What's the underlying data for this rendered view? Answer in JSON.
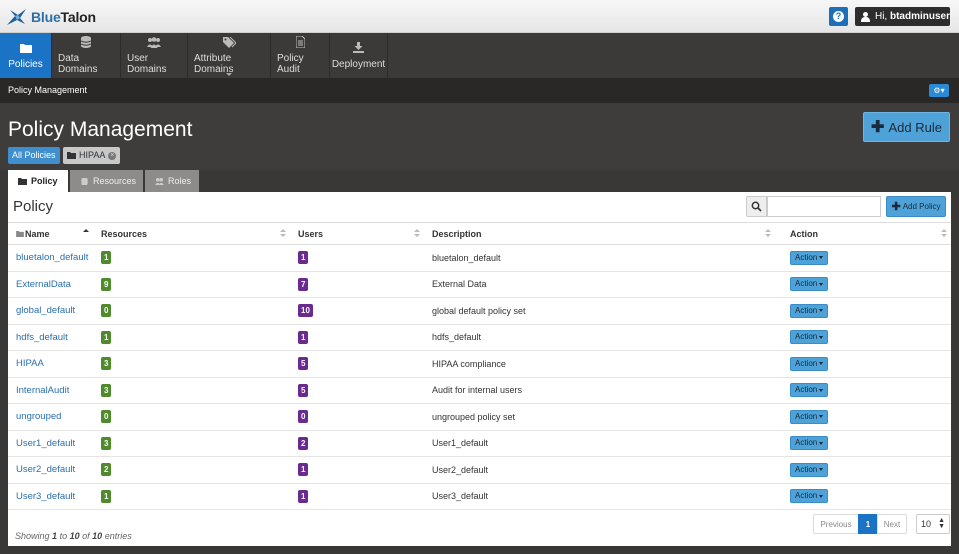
{
  "app": {
    "logo_blue": "Blue",
    "logo_dark": "Talon",
    "help_label": "?",
    "user_greeting": "Hi,",
    "user_name": "btadminuser"
  },
  "nav": {
    "items": [
      {
        "label": "Policies",
        "icon": "folder-icon"
      },
      {
        "label": "Data Domains",
        "icon": "database-icon"
      },
      {
        "label": "User Domains",
        "icon": "users-icon"
      },
      {
        "label": "Attribute Domains",
        "icon": "tags-icon"
      },
      {
        "label": "Policy Audit",
        "icon": "file-icon"
      },
      {
        "label": "Deployment",
        "icon": "download-icon"
      }
    ]
  },
  "subbar": {
    "title": "Policy Management"
  },
  "header": {
    "title": "Policy Management",
    "crumb_all": "All Policies",
    "crumb_tag": "HIPAA",
    "add_rule": "Add Rule"
  },
  "tabs": [
    {
      "label": "Policy",
      "active": true
    },
    {
      "label": "Resources",
      "active": false
    },
    {
      "label": "Roles",
      "active": false
    }
  ],
  "panel": {
    "title": "Policy",
    "search_placeholder": "",
    "add_policy": "Add Policy"
  },
  "table": {
    "headers": [
      "Name",
      "Resources",
      "Users",
      "Description",
      "Action"
    ],
    "rows": [
      {
        "name": "bluetalon_default",
        "resources": "1",
        "users": "1",
        "description": "bluetalon_default",
        "action": "Action"
      },
      {
        "name": "ExternalData",
        "resources": "9",
        "users": "7",
        "description": "External Data",
        "action": "Action"
      },
      {
        "name": "global_default",
        "resources": "0",
        "users": "10",
        "description": "global default policy set",
        "action": "Action"
      },
      {
        "name": "hdfs_default",
        "resources": "1",
        "users": "1",
        "description": "hdfs_default",
        "action": "Action"
      },
      {
        "name": "HIPAA",
        "resources": "3",
        "users": "5",
        "description": "HIPAA compliance",
        "action": "Action"
      },
      {
        "name": "InternalAudit",
        "resources": "3",
        "users": "5",
        "description": "Audit for internal users",
        "action": "Action"
      },
      {
        "name": "ungrouped",
        "resources": "0",
        "users": "0",
        "description": "ungrouped policy set",
        "action": "Action"
      },
      {
        "name": "User1_default",
        "resources": "3",
        "users": "2",
        "description": "User1_default",
        "action": "Action"
      },
      {
        "name": "User2_default",
        "resources": "2",
        "users": "1",
        "description": "User2_default",
        "action": "Action"
      },
      {
        "name": "User3_default",
        "resources": "1",
        "users": "1",
        "description": "User3_default",
        "action": "Action"
      }
    ]
  },
  "footer": {
    "showing": "Showing",
    "from": "1",
    "to_word": "to",
    "to": "10",
    "of_word": "of",
    "total": "10",
    "entries": "entries",
    "previous": "Previous",
    "current_page": "1",
    "next": "Next",
    "page_size": "10"
  },
  "colors": {
    "accent": "#1a73c4",
    "resources_badge": "#4f8a2c",
    "users_badge": "#6a2a8f"
  }
}
